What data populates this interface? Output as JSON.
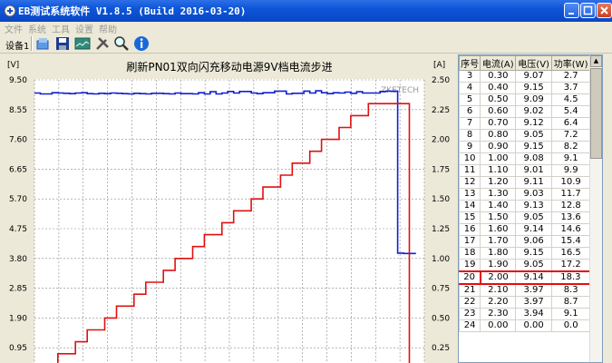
{
  "window": {
    "title": "EB测试系统软件 V1.8.5 (Build 2016-03-20)"
  },
  "menu": [
    "文件",
    "系统",
    "工具",
    "设置",
    "帮助"
  ],
  "toolbar": {
    "device_label": "设备1"
  },
  "chart_data": {
    "type": "line",
    "title": "刷新PN01双向闪充移动电源9V档电流步进",
    "watermark": "ZKETECH",
    "left_unit": "[V]",
    "right_unit": "[A]",
    "left_ticks": [
      "9.50",
      "8.55",
      "7.60",
      "6.65",
      "5.70",
      "4.75",
      "3.80",
      "2.85",
      "1.90",
      "0.95"
    ],
    "right_ticks": [
      "2.50",
      "2.25",
      "2.00",
      "1.75",
      "1.50",
      "1.25",
      "1.00",
      "0.75",
      "0.50",
      "0.25"
    ],
    "left_range": [
      0,
      9.5
    ],
    "right_range": [
      0,
      2.5
    ],
    "series": [
      {
        "axis": "left",
        "color": "#1020d0",
        "values": [
          9.08,
          9.05,
          9.05,
          9.09,
          9.08,
          9.07,
          9.06,
          9.08,
          9.09,
          9.06,
          9.05,
          9.07,
          9.06,
          9.08,
          9.07,
          9.06,
          9.05,
          9.07,
          9.06,
          9.05,
          9.07,
          9.07,
          9.06,
          9.05,
          9.08,
          9.06,
          9.06,
          9.05,
          9.09,
          9.05,
          9.12,
          9.05,
          9.08,
          9.13,
          9.08,
          9.13,
          9.13,
          9.08,
          9.06,
          9.09,
          9.09,
          9.14,
          9.14,
          9.05,
          9.07,
          9.07,
          9.14,
          9.08,
          9.15,
          9.09,
          9.06,
          9.09,
          9.08,
          9.11,
          9.07,
          9.12,
          9.08,
          9.08,
          9.08,
          9.13,
          9.14,
          9.14,
          3.97,
          3.96,
          3.96,
          3.94
        ]
      },
      {
        "axis": "right",
        "color": "#e01010",
        "values": [
          0.0,
          0.0,
          0.1,
          0.1,
          0.2,
          0.2,
          0.2,
          0.3,
          0.3,
          0.4,
          0.4,
          0.4,
          0.5,
          0.5,
          0.6,
          0.6,
          0.6,
          0.7,
          0.7,
          0.8,
          0.8,
          0.8,
          0.9,
          0.9,
          1.0,
          1.0,
          1.0,
          1.1,
          1.1,
          1.2,
          1.2,
          1.2,
          1.3,
          1.3,
          1.4,
          1.4,
          1.4,
          1.5,
          1.5,
          1.6,
          1.6,
          1.6,
          1.7,
          1.7,
          1.8,
          1.8,
          1.8,
          1.9,
          1.9,
          2.0,
          2.0,
          2.0,
          2.1,
          2.1,
          2.2,
          2.2,
          2.2,
          2.3,
          2.3,
          2.3,
          2.3,
          2.3,
          2.3,
          2.3,
          0.0,
          0.0
        ]
      }
    ]
  },
  "table": {
    "headers": [
      "序号",
      "电流(A)",
      "电压(V)",
      "功率(W)"
    ],
    "rows": [
      [
        "3",
        "0.30",
        "9.07",
        "2.7"
      ],
      [
        "4",
        "0.40",
        "9.15",
        "3.7"
      ],
      [
        "5",
        "0.50",
        "9.09",
        "4.5"
      ],
      [
        "6",
        "0.60",
        "9.02",
        "5.4"
      ],
      [
        "7",
        "0.70",
        "9.12",
        "6.4"
      ],
      [
        "8",
        "0.80",
        "9.05",
        "7.2"
      ],
      [
        "9",
        "0.90",
        "9.15",
        "8.2"
      ],
      [
        "10",
        "1.00",
        "9.08",
        "9.1"
      ],
      [
        "11",
        "1.10",
        "9.01",
        "9.9"
      ],
      [
        "12",
        "1.20",
        "9.11",
        "10.9"
      ],
      [
        "13",
        "1.30",
        "9.03",
        "11.7"
      ],
      [
        "14",
        "1.40",
        "9.13",
        "12.8"
      ],
      [
        "15",
        "1.50",
        "9.05",
        "13.6"
      ],
      [
        "16",
        "1.60",
        "9.14",
        "14.6"
      ],
      [
        "17",
        "1.70",
        "9.06",
        "15.4"
      ],
      [
        "18",
        "1.80",
        "9.15",
        "16.5"
      ],
      [
        "19",
        "1.90",
        "9.05",
        "17.2"
      ],
      [
        "20",
        "2.00",
        "9.14",
        "18.3"
      ],
      [
        "21",
        "2.10",
        "3.97",
        "8.3"
      ],
      [
        "22",
        "2.20",
        "3.97",
        "8.7"
      ],
      [
        "23",
        "2.30",
        "3.94",
        "9.1"
      ],
      [
        "24",
        "0.00",
        "0.00",
        "0.0"
      ]
    ],
    "highlight_row": "20"
  }
}
